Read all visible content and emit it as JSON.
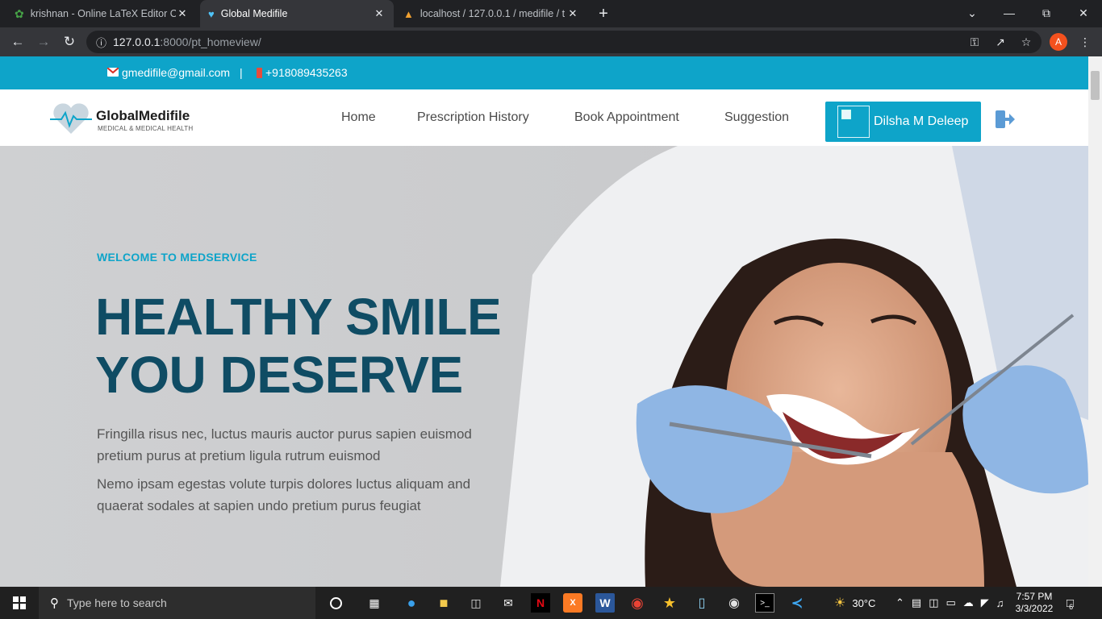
{
  "browser": {
    "tabs": [
      {
        "title": "krishnan - Online LaTeX Editor Ov",
        "icon": "overleaf-icon"
      },
      {
        "title": "Global Medifile",
        "icon": "heartbeat-icon",
        "active": true
      },
      {
        "title": "localhost / 127.0.0.1 / medifile / t",
        "icon": "phpmyadmin-icon"
      }
    ],
    "url_host": "127.0.0.1",
    "url_path": ":8000/pt_homeview/",
    "profile_initial": "A"
  },
  "site": {
    "email": "gmedifile@gmail.com",
    "separator": "|",
    "phone": "+918089435263",
    "logo_name": "GlobalMedifile",
    "logo_tagline": "MEDICAL & MEDICAL HEALTH",
    "nav": [
      {
        "label": "Home"
      },
      {
        "label": "Prescription History"
      },
      {
        "label": "Book Appointment"
      },
      {
        "label": "Suggestion"
      }
    ],
    "user_name": "Dilsha M Deleep",
    "accent": "#0ea4c9",
    "heading_color": "#0f4c64"
  },
  "hero": {
    "eyebrow": "WELCOME TO MEDSERVICE",
    "title_line1": "HEALTHY SMILE",
    "title_line2": "YOU DESERVE",
    "para1_line1": "Fringilla risus nec, luctus mauris auctor purus sapien euismod",
    "para1_line2": "pretium purus at pretium ligula rutrum euismod",
    "para2_line1": "Nemo ipsam egestas volute turpis dolores luctus aliquam and",
    "para2_line2": "quaerat sodales at sapien undo pretium purus feugiat"
  },
  "taskbar": {
    "search_placeholder": "Type here to search",
    "temperature": "30°C",
    "time": "7:57 PM",
    "date": "3/3/2022",
    "notifications": "6"
  }
}
